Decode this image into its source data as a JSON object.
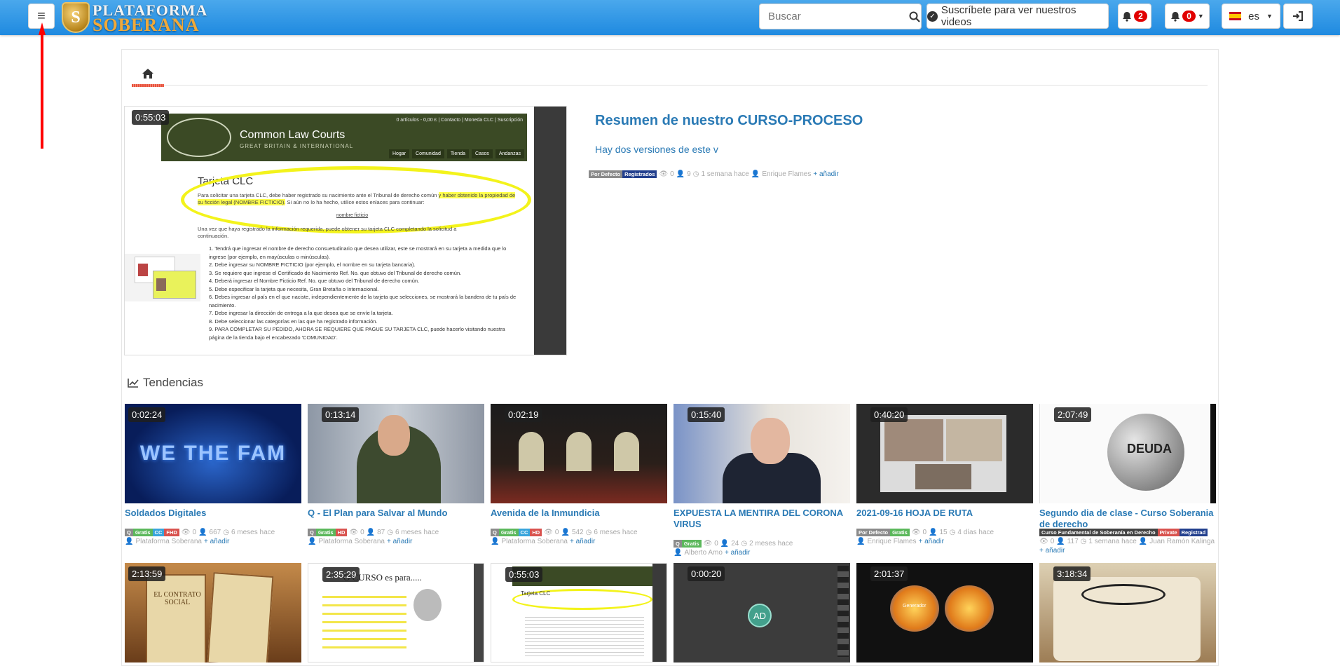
{
  "header": {
    "menu_icon": "hamburger-icon",
    "logo_top": "PLATAFORMA",
    "logo_bottom": "SOBERANA",
    "search_placeholder": "Buscar",
    "subscribe_label": "Suscríbete para ver nuestros videos",
    "notifications_count": "2",
    "alerts_count": "0",
    "language": "es",
    "accent_color": "#2a8ee2"
  },
  "featured": {
    "duration": "0:55:03",
    "title": "Resumen de nuestro CURSO-PROCESO",
    "description": "Hay dos versiones de este v",
    "tags": [
      "Por Defecto",
      "Registrados"
    ],
    "views": "0",
    "likes": "9",
    "time": "1 semana hace",
    "author": "Enrique Flames",
    "add_label": "añadir",
    "thumb": {
      "topnote": "0 artículos - 0,00 £  |  Contacto  |  Moneda CLC  |  Suscripción",
      "site_title": "Common Law Courts",
      "site_sub": "GREAT BRITAIN & INTERNATIONAL",
      "nav": [
        "Hogar",
        "Comunidad",
        "Tienda",
        "Casos",
        "Andanzas"
      ],
      "heading": "Tarjeta CLC",
      "p1a": "Para solicitar una tarjeta CLC, debe haber registrado su nacimiento ante el Tribunal de derecho común ",
      "p1b": "y haber obtenido la propiedad de su ficción legal (NOMBRE FICTICIO).",
      "p1c": " Si aún no lo ha hecho, utilice estos enlaces para continuar:",
      "link": "nombre ficticio",
      "p2": "Una vez que haya registrado la información requerida, puede obtener su tarjeta CLC completando la solicitud a continuación.",
      "list": [
        "1. Tendrá que ingresar el nombre de derecho consuetudinario que desea utilizar, este se mostrará en su tarjeta a medida que lo ingrese (por ejemplo, en mayúsculas o minúsculas).",
        "2. Debe ingresar su NOMBRE FICTICIO (por ejemplo, el nombre en su tarjeta bancaria).",
        "3. Se requiere que ingrese el Certificado de Nacimiento Ref. No. que obtuvo del Tribunal de derecho común.",
        "4. Deberá ingresar el Nombre Ficticio Ref. No. que obtuvo del Tribunal de derecho común.",
        "5. Debe especificar la tarjeta que necesita, Gran Bretaña o Internacional.",
        "6. Debes ingresar al país en el que naciste, independientemente de la tarjeta que selecciones, se mostrará la bandera de tu país de nacimiento.",
        "7. Debe ingresar la dirección de entrega a la que desea que se envíe la tarjeta.",
        "8. Debe seleccionar las categorías en las que ha registrado información.",
        "9. PARA COMPLETAR SU PEDIDO, AHORA SE REQUIERE QUE PAGUE SU TARJETA CLC, puede hacerlo visitando nuestra página de la tienda bajo el encabezado 'COMUNIDAD'."
      ]
    }
  },
  "trending": {
    "label": "Tendencias",
    "videos": [
      {
        "duration": "0:02:24",
        "title": "Soldados Digitales",
        "thumb_text": "WE THE FAM",
        "tags": [
          "Q",
          "Gratis",
          "CC",
          "FHD"
        ],
        "views": "0",
        "likes": "667",
        "time": "6 meses hace",
        "author": "Plataforma Soberana",
        "add": "añadir"
      },
      {
        "duration": "0:13:14",
        "title": "Q - El Plan para Salvar al Mundo",
        "tags": [
          "Q",
          "Gratis",
          "HD"
        ],
        "views": "0",
        "likes": "87",
        "time": "6 meses hace",
        "author": "Plataforma Soberana",
        "add": "añadir"
      },
      {
        "duration": "0:02:19",
        "title": "Avenida de la Inmundicia",
        "tags": [
          "Q",
          "Gratis",
          "CC",
          "HD"
        ],
        "views": "0",
        "likes": "542",
        "time": "6 meses hace",
        "author": "Plataforma Soberana",
        "add": "añadir"
      },
      {
        "duration": "0:15:40",
        "title": "EXPUESTA LA MENTIRA DEL CORONA VIRUS",
        "tags": [
          "Q",
          "Gratis"
        ],
        "views": "0",
        "likes": "24",
        "time": "2 meses hace",
        "author": "Alberto Amo",
        "add": "añadir"
      },
      {
        "duration": "0:40:20",
        "title": "2021-09-16 HOJA DE RUTA",
        "tags": [
          "Por Defecto",
          "Gratis"
        ],
        "views": "0",
        "likes": "15",
        "time": "4 días hace",
        "author": "Enrique Flames",
        "add": "añadir"
      },
      {
        "duration": "2:07:49",
        "title": "Segundo dia de clase - Curso Soberania de derecho",
        "thumb_text": "DEUDA",
        "tags": [
          "Curso Fundamental de Soberanía en Derecho",
          "Private",
          "Registrad"
        ],
        "views": "0",
        "likes": "117",
        "time": "1 semana hace",
        "author": "Juan Ramón Kalinga",
        "add": "añadir"
      }
    ],
    "row2": [
      {
        "duration": "2:13:59",
        "thumb_text": "EL CONTRATO SOCIAL"
      },
      {
        "duration": "2:35:29",
        "thumb_text": "O CURSO es para....."
      },
      {
        "duration": "0:55:03",
        "thumb_text": "Tarjeta CLC"
      },
      {
        "duration": "0:00:20",
        "thumb_text": "AD"
      },
      {
        "duration": "2:01:37",
        "thumb_text": "Generador"
      },
      {
        "duration": "3:18:34",
        "thumb_text": ""
      }
    ]
  }
}
